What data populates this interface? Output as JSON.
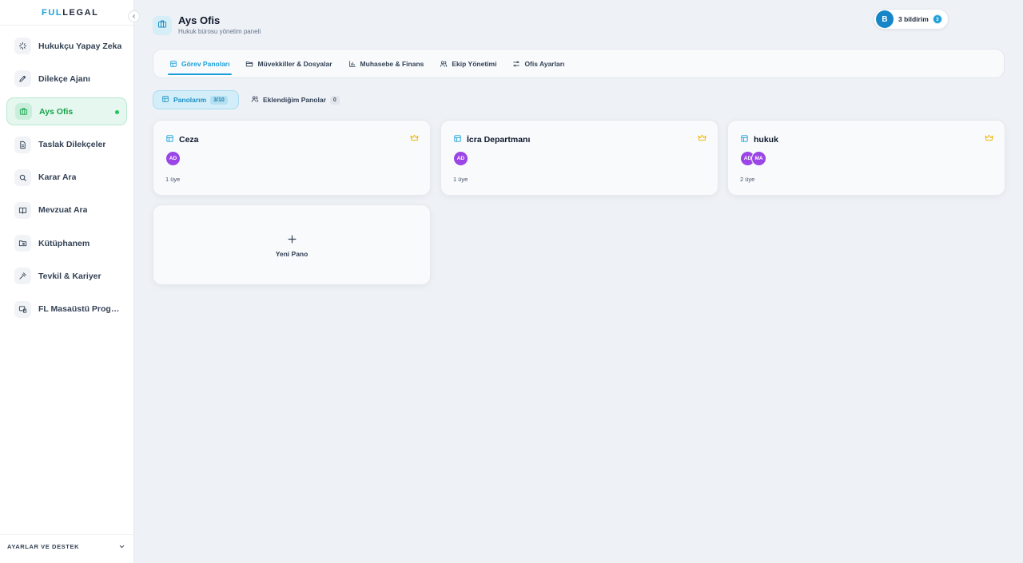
{
  "brand": {
    "prefix": "FUL",
    "suffix": "LEGAL",
    "accent_color": "#1aa0d8"
  },
  "sidebar": {
    "collapse_icon": "chevron-left-icon",
    "items": [
      {
        "label": "Hukukçu Yapay Zeka",
        "icon": "sparkles-icon",
        "active": false
      },
      {
        "label": "Dilekçe Ajanı",
        "icon": "pen-icon",
        "active": false
      },
      {
        "label": "Ays Ofis",
        "icon": "briefcase-icon",
        "active": true
      },
      {
        "label": "Taslak Dilekçeler",
        "icon": "document-icon",
        "active": false
      },
      {
        "label": "Karar Ara",
        "icon": "search-icon",
        "active": false
      },
      {
        "label": "Mevzuat Ara",
        "icon": "book-icon",
        "active": false
      },
      {
        "label": "Kütüphanem",
        "icon": "folder-search-icon",
        "active": false
      },
      {
        "label": "Tevkil & Kariyer",
        "icon": "gavel-icon",
        "active": false
      },
      {
        "label": "FL Masaüstü Programı",
        "icon": "desktop-icon",
        "active": false
      }
    ],
    "footer_label": "AYARLAR VE DESTEK"
  },
  "header": {
    "title": "Ays Ofis",
    "subtitle": "Hukuk bürosu yönetim paneli",
    "icon": "briefcase-icon"
  },
  "notifications": {
    "avatar_letter": "B",
    "label": "3 bildirim",
    "count": "3"
  },
  "tabs": [
    {
      "label": "Görev Panoları",
      "icon": "board-icon",
      "active": true
    },
    {
      "label": "Müvekkiller & Dosyalar",
      "icon": "folder-icon",
      "active": false
    },
    {
      "label": "Muhasebe & Finans",
      "icon": "bar-chart-icon",
      "active": false
    },
    {
      "label": "Ekip Yönetimi",
      "icon": "users-icon",
      "active": false
    },
    {
      "label": "Ofis Ayarları",
      "icon": "sliders-icon",
      "active": false
    }
  ],
  "subtabs": {
    "mine": {
      "label": "Panolarım",
      "count": "3/10"
    },
    "added": {
      "label": "Eklendiğim Panolar",
      "count": "0"
    }
  },
  "boards": [
    {
      "title": "Ceza",
      "members": [
        "AD"
      ],
      "member_count": "1 üye"
    },
    {
      "title": "İcra Departmanı",
      "members": [
        "AD"
      ],
      "member_count": "1 üye"
    },
    {
      "title": "hukuk",
      "members": [
        "AD",
        "MA"
      ],
      "member_count": "2 üye"
    }
  ],
  "new_board": {
    "label": "Yeni Pano"
  },
  "colors": {
    "active_green": "#16a34a",
    "member_avatar": "#9b45e6",
    "crown": "#f2b705"
  }
}
